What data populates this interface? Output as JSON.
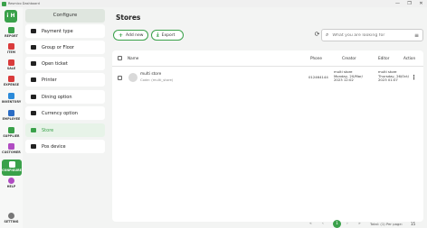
{
  "window": {
    "title": "Resmico Dashboard",
    "controls": [
      "—",
      "❐",
      "✕"
    ]
  },
  "logo": {
    "text": "i H"
  },
  "leftnav": [
    {
      "name": "report",
      "label": "REPORT",
      "icon": "chart-icon",
      "color": "#3aa14a"
    },
    {
      "name": "item",
      "label": "ITEM",
      "icon": "gift-icon",
      "color": "#d93b3b"
    },
    {
      "name": "sale",
      "label": "SALE",
      "icon": "cut-icon",
      "color": "#d93b3b"
    },
    {
      "name": "expense",
      "label": "EXPENSE",
      "icon": "money-icon",
      "color": "#d93b3b"
    },
    {
      "name": "inventory",
      "label": "INVENTORY",
      "icon": "inventory-icon",
      "color": "#2b8ad9"
    },
    {
      "name": "employee",
      "label": "EMPLOYEE",
      "icon": "id-card-icon",
      "color": "#2b6cc4"
    },
    {
      "name": "supplier",
      "label": "SUPPLIER",
      "icon": "truck-icon",
      "color": "#3aa14a"
    },
    {
      "name": "customer",
      "label": "CUSTOMER",
      "icon": "customer-icon",
      "color": "#b04cc2"
    },
    {
      "name": "configure",
      "label": "CONFIGURE",
      "icon": "configure-icon",
      "color": "#ffffff",
      "active": true
    },
    {
      "name": "help",
      "label": "HELP",
      "icon": "help-icon",
      "color": "#b04cc2"
    },
    {
      "name": "setting",
      "label": "SETTING",
      "icon": "gear-icon",
      "color": "#777777"
    }
  ],
  "configure": {
    "title": "Configure",
    "items": [
      {
        "label": "Payment type",
        "icon": "card-icon"
      },
      {
        "label": "Group or Floor",
        "icon": "group-icon"
      },
      {
        "label": "Open ticket",
        "icon": "ticket-icon"
      },
      {
        "label": "Printer",
        "icon": "printer-icon"
      },
      {
        "label": "Dining option",
        "icon": "dining-icon"
      },
      {
        "label": "Currency option",
        "icon": "currency-icon"
      },
      {
        "label": "Store",
        "icon": "store-icon",
        "active": true
      },
      {
        "label": "Pos device",
        "icon": "pos-device-icon"
      }
    ]
  },
  "main": {
    "title": "Stores",
    "add_label": "Add new",
    "export_label": "Export",
    "search_placeholder": "What you are looking for",
    "columns": {
      "name": "Name",
      "phone": "Phone",
      "creator": "Creator",
      "editor": "Editor",
      "action": "Action"
    },
    "rows": [
      {
        "name": "multi store",
        "code": "Code: (multi_store)",
        "phone": "012464144",
        "creator_name": "multi store",
        "creator_date": "Monday, 20/Mar/",
        "creator_time": "2023 12:02",
        "editor_name": "multi store",
        "editor_date": "Thursday, 26/Oct/",
        "editor_time": "2023 01:07"
      }
    ],
    "pagination": {
      "first": "«",
      "prev": "‹",
      "current": "1",
      "next": "›",
      "last": "»",
      "total": "Total: (1) Per page:",
      "per_page": "15"
    }
  }
}
